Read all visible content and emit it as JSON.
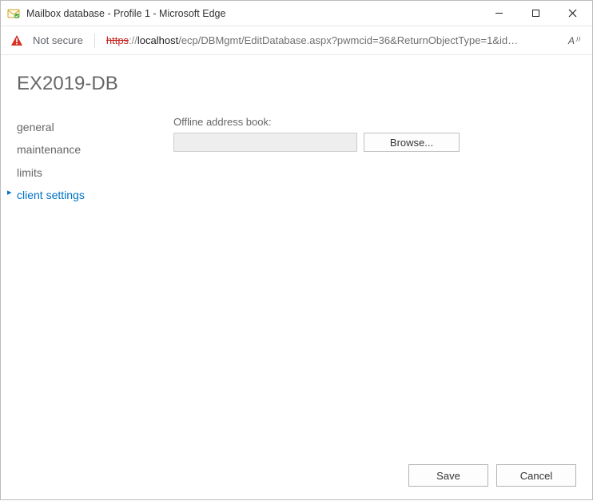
{
  "window": {
    "title": "Mailbox database - Profile 1 - Microsoft Edge"
  },
  "addressbar": {
    "secure_label": "Not secure",
    "url_scheme": "https",
    "url_slashes": "://",
    "url_host": "localhost",
    "url_path": "/ecp/DBMgmt/EditDatabase.aspx?pwmcid=36&ReturnObjectType=1&id…",
    "read_aloud_label": "A⁾⁾"
  },
  "page": {
    "title": "EX2019-DB"
  },
  "nav": {
    "items": [
      {
        "label": "general",
        "id": "general",
        "active": false
      },
      {
        "label": "maintenance",
        "id": "maintenance",
        "active": false
      },
      {
        "label": "limits",
        "id": "limits",
        "active": false
      },
      {
        "label": "client settings",
        "id": "client-settings",
        "active": true
      }
    ]
  },
  "main": {
    "oab_label": "Offline address book:",
    "oab_value": "",
    "browse_label": "Browse..."
  },
  "footer": {
    "save_label": "Save",
    "cancel_label": "Cancel"
  }
}
